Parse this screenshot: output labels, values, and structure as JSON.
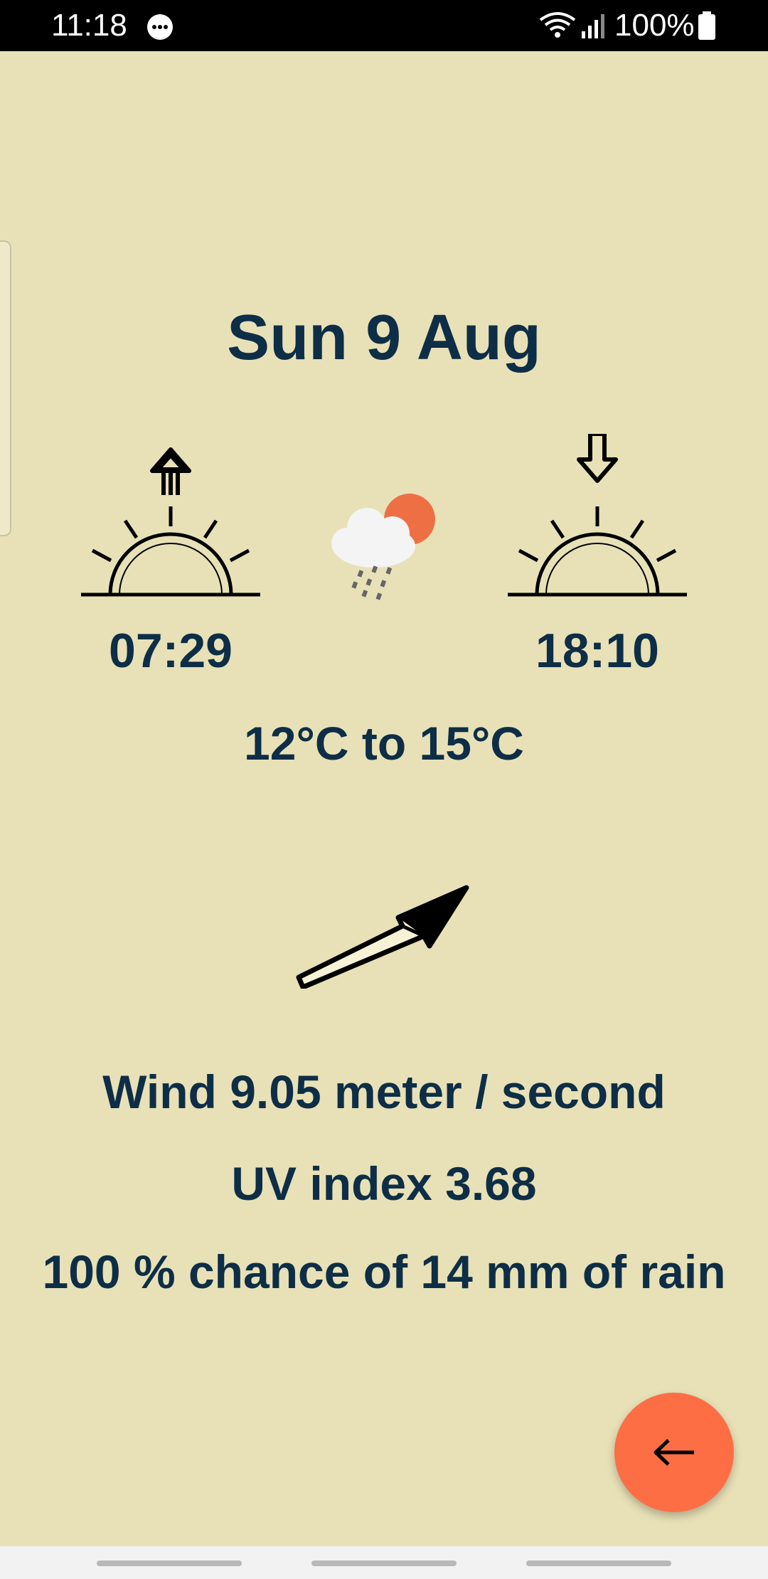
{
  "status_bar": {
    "time": "11:18",
    "battery": "100%",
    "icons": [
      "message-icon",
      "wifi-icon",
      "signal-icon",
      "battery-icon"
    ]
  },
  "forecast": {
    "date": "Sun 9 Aug",
    "sunrise": "07:29",
    "sunset": "18:10",
    "temperature_range": "12°C to 15°C",
    "wind": "Wind 9.05 meter / second",
    "uv_index": "UV index 3.68",
    "rain": "100 % chance of 14 mm of rain",
    "weather_icon": "rain-cloud-sun-icon",
    "wind_direction_icon": "wind-direction-arrow-icon"
  },
  "fab": {
    "icon": "back-arrow-icon",
    "color": "#fd6e45"
  },
  "colors": {
    "background": "#e8e1b7",
    "text": "#0d2e46"
  }
}
